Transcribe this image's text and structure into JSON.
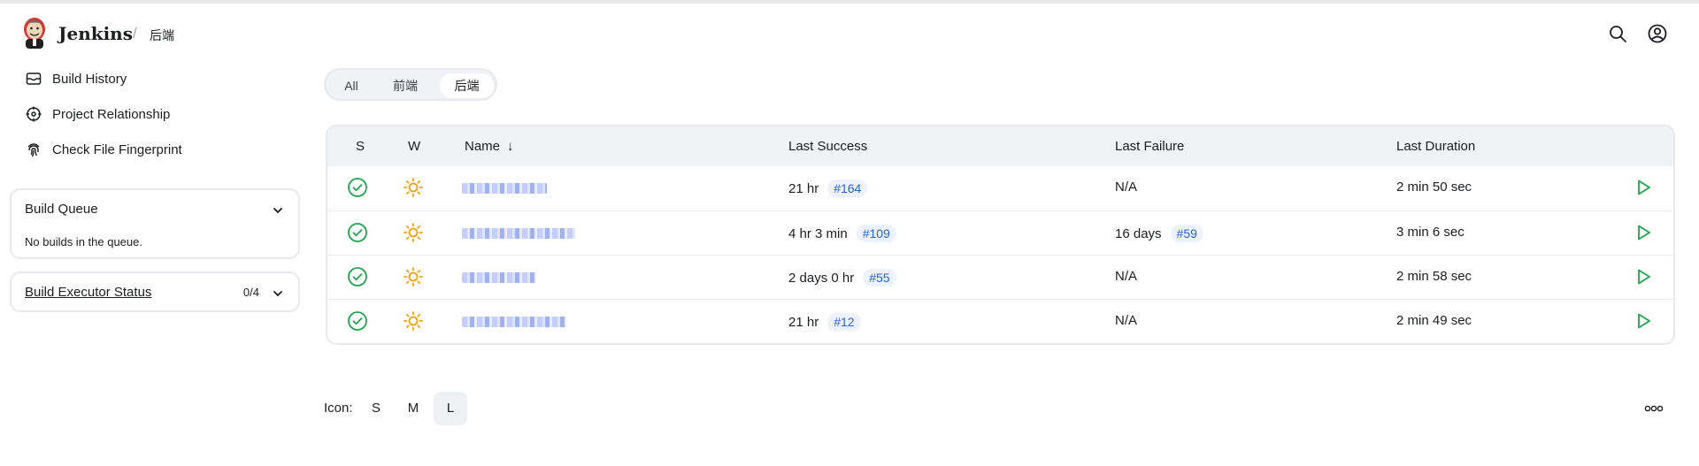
{
  "header": {
    "brand": "Jenkins",
    "separator": "/",
    "breadcrumb": "后端",
    "icons": [
      "jenkins-logo",
      "search-icon",
      "user-icon"
    ]
  },
  "sidebar": {
    "links": [
      {
        "label": "Build History",
        "icon": "build-history-icon"
      },
      {
        "label": "Project Relationship",
        "icon": "project-relationship-icon"
      },
      {
        "label": "Check File Fingerprint",
        "icon": "fingerprint-icon"
      }
    ],
    "build_queue": {
      "title": "Build Queue",
      "empty_text": "No builds in the queue."
    },
    "build_executor": {
      "title": "Build Executor Status",
      "count": "0/4"
    }
  },
  "tabs": [
    {
      "label": "All",
      "active": false
    },
    {
      "label": "前端",
      "active": false
    },
    {
      "label": "后端",
      "active": true
    }
  ],
  "table": {
    "headers": {
      "s": "S",
      "w": "W",
      "name": "Name",
      "sort_arrow": "↓",
      "last_success": "Last Success",
      "last_failure": "Last Failure",
      "last_duration": "Last Duration"
    },
    "rows": [
      {
        "status": "success",
        "weather": "sunny",
        "ls_time": "21 hr",
        "ls_build": "#164",
        "lf_time": "N/A",
        "lf_build": "",
        "duration": "2 min 50 sec"
      },
      {
        "status": "success",
        "weather": "sunny",
        "ls_time": "4 hr 3 min",
        "ls_build": "#109",
        "lf_time": "16 days",
        "lf_build": "#59",
        "duration": "3 min 6 sec"
      },
      {
        "status": "success",
        "weather": "sunny",
        "ls_time": "2 days 0 hr",
        "ls_build": "#55",
        "lf_time": "N/A",
        "lf_build": "",
        "duration": "2 min 58 sec"
      },
      {
        "status": "success",
        "weather": "sunny",
        "ls_time": "21 hr",
        "ls_build": "#12",
        "lf_time": "N/A",
        "lf_build": "",
        "duration": "2 min 49 sec"
      }
    ]
  },
  "footer": {
    "icon_label": "Icon:",
    "sizes": [
      {
        "label": "S",
        "active": false
      },
      {
        "label": "M",
        "active": false
      },
      {
        "label": "L",
        "active": true
      }
    ]
  },
  "colors": {
    "success": "#1ea64b",
    "weather": "#f0a30a",
    "link": "#2463d6",
    "border": "#e8e9ef"
  }
}
